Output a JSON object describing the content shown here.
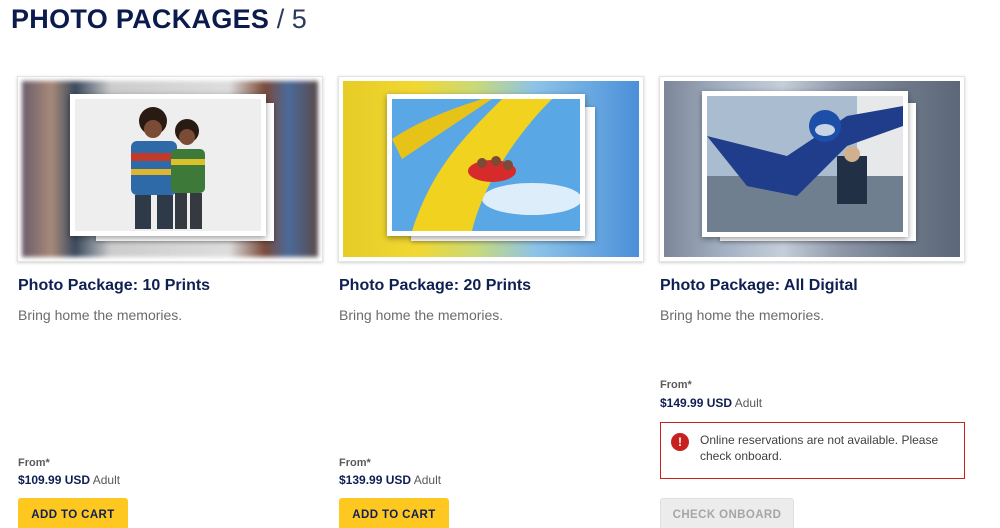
{
  "header": {
    "title": "PHOTO PACKAGES",
    "separator": "/ 5"
  },
  "products": [
    {
      "title": "Photo Package: 10 Prints",
      "description": "Bring home the memories.",
      "from_label": "From*",
      "price": "$109.99 USD",
      "price_unit": "Adult",
      "button": "ADD TO CART"
    },
    {
      "title": "Photo Package: 20 Prints",
      "description": "Bring home the memories.",
      "from_label": "From*",
      "price": "$139.99 USD",
      "price_unit": "Adult",
      "button": "ADD TO CART"
    },
    {
      "title": "Photo Package: All Digital",
      "description": "Bring home the memories.",
      "from_label": "From*",
      "price": "$149.99 USD",
      "price_unit": "Adult",
      "alert": "Online reservations are not available. Please check onboard.",
      "button": "CHECK ONBOARD"
    }
  ],
  "colors": {
    "title_navy": "#0b1b4d",
    "button_yellow": "#ffc820",
    "alert_red": "#c8201f",
    "disabled_gray": "#ececec"
  },
  "icons": {
    "alert": "exclamation-circle-icon"
  }
}
